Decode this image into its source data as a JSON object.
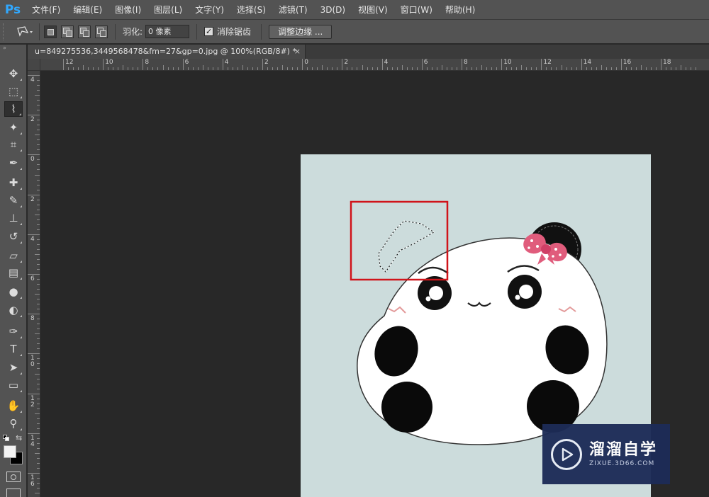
{
  "app": {
    "logo": "Ps"
  },
  "menu": [
    "文件(F)",
    "编辑(E)",
    "图像(I)",
    "图层(L)",
    "文字(Y)",
    "选择(S)",
    "滤镜(T)",
    "3D(D)",
    "视图(V)",
    "窗口(W)",
    "帮助(H)"
  ],
  "options": {
    "feather_label": "羽化:",
    "feather_value": "0 像素",
    "antialias_label": "消除锯齿",
    "antialias_checked": true,
    "refine_label": "调整边缘 ..."
  },
  "document": {
    "tab_title": "u=849275536,3449568478&fm=27&gp=0.jpg @ 100%(RGB/8#) *",
    "close_glyph": "×"
  },
  "ruler_top_labels": [
    "12",
    "10",
    "8",
    "6",
    "4",
    "2",
    "0",
    "2",
    "4",
    "6",
    "8",
    "10",
    "12",
    "14",
    "16",
    "18"
  ],
  "ruler_left_labels": [
    "4",
    "2",
    "0",
    "2",
    "4",
    "6",
    "8",
    "1 0",
    "1 2",
    "1 4",
    "1 6"
  ],
  "tools": [
    {
      "name": "move-tool-icon",
      "glyph": "✥"
    },
    {
      "name": "rect-marquee-tool-icon",
      "glyph": "⬚"
    },
    {
      "name": "polygonal-lasso-tool-icon",
      "glyph": "⌇",
      "active": true
    },
    {
      "name": "magic-wand-tool-icon",
      "glyph": "✦"
    },
    {
      "name": "crop-tool-icon",
      "glyph": "⌗"
    },
    {
      "name": "eyedropper-tool-icon",
      "glyph": "✒"
    },
    {
      "name": "healing-brush-tool-icon",
      "glyph": "✚"
    },
    {
      "name": "brush-tool-icon",
      "glyph": "✎"
    },
    {
      "name": "clone-stamp-tool-icon",
      "glyph": "⊥"
    },
    {
      "name": "history-brush-tool-icon",
      "glyph": "↺"
    },
    {
      "name": "eraser-tool-icon",
      "glyph": "▱"
    },
    {
      "name": "gradient-tool-icon",
      "glyph": "▤"
    },
    {
      "name": "blur-tool-icon",
      "glyph": "●"
    },
    {
      "name": "dodge-tool-icon",
      "glyph": "◐"
    },
    {
      "name": "pen-tool-icon",
      "glyph": "✑"
    },
    {
      "name": "type-tool-icon",
      "glyph": "T"
    },
    {
      "name": "path-select-tool-icon",
      "glyph": "➤"
    },
    {
      "name": "rectangle-shape-tool-icon",
      "glyph": "▭"
    },
    {
      "name": "hand-tool-icon",
      "glyph": "✋"
    },
    {
      "name": "zoom-tool-icon",
      "glyph": "⚲"
    }
  ],
  "watermark": {
    "main": "溜溜自学",
    "sub": "ZIXUE.3D66.COM"
  },
  "colors": {
    "foreground": "#f2f2f2",
    "background": "#000000",
    "selection_box": "#d0141a",
    "image_bg": "#ccdcdc"
  }
}
